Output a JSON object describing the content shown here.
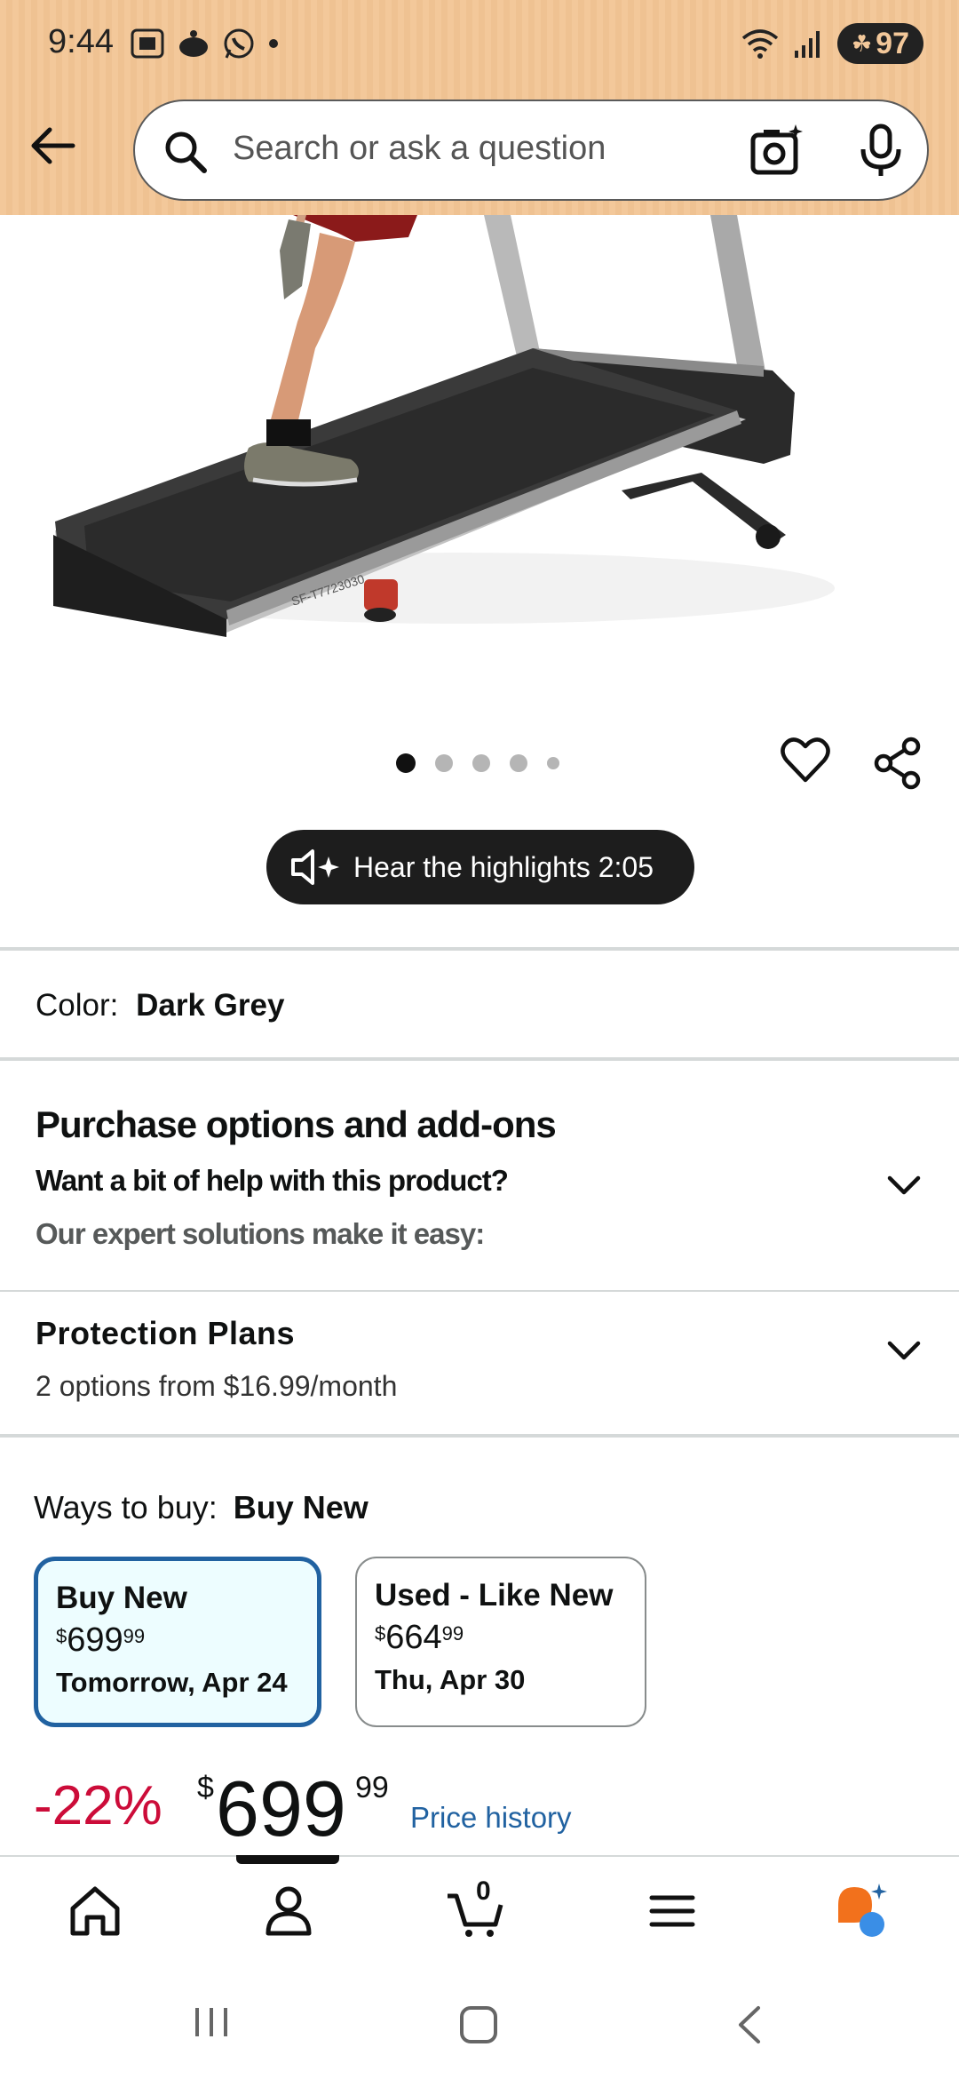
{
  "status_bar": {
    "time": "9:44",
    "battery": "97"
  },
  "search": {
    "placeholder": "Search or ask a question"
  },
  "product_image": {
    "model_text": "SF-T7723030"
  },
  "carousel": {
    "dot_count": 5,
    "active_index": 0
  },
  "highlights": {
    "label": "Hear the highlights 2:05"
  },
  "color": {
    "label": "Color:",
    "value": "Dark Grey"
  },
  "purchase_options": {
    "title": "Purchase options and add-ons",
    "subtitle": "Want a bit of help with this product?",
    "description": "Our expert solutions make it easy:"
  },
  "protection": {
    "title": "Protection Plans",
    "subtitle": "2 options from $16.99/month"
  },
  "ways_to_buy": {
    "label": "Ways to buy:",
    "value": "Buy New",
    "options": [
      {
        "title": "Buy New",
        "price_symbol": "$",
        "price_whole": "699",
        "price_cents": "99",
        "delivery": "Tomorrow, Apr 24",
        "selected": true
      },
      {
        "title": "Used - Like New",
        "price_symbol": "$",
        "price_whole": "664",
        "price_cents": "99",
        "delivery": "Thu, Apr 30",
        "selected": false
      }
    ]
  },
  "price": {
    "discount": "-22%",
    "symbol": "$",
    "whole": "699",
    "cents": "99",
    "history_link": "Price history"
  },
  "bottom_nav": {
    "cart_count": "0",
    "items": [
      "home-icon",
      "account-icon",
      "cart-icon",
      "menu-icon",
      "rufus-icon"
    ]
  },
  "colors": {
    "header_bg": "#f3c89a",
    "accent_blue": "#2162a1",
    "discount_red": "#cc0c39",
    "selected_card_bg": "#edfdff"
  }
}
